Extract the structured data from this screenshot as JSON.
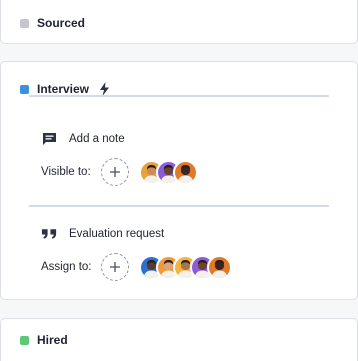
{
  "stages": {
    "sourced": {
      "label": "Sourced",
      "color": "#c4c6cb"
    },
    "interview": {
      "label": "Interview",
      "color": "#3d8fe0",
      "icon": "lightning-bolt-icon",
      "actions": [
        {
          "title": "Add a note",
          "icon": "chat-bubble-icon",
          "assign_label": "Visible to:",
          "avatars": [
            {
              "bg": "#e8a23a",
              "skin": "#c98a5c"
            },
            {
              "bg": "#8e5bd6",
              "skin": "#6a4432"
            },
            {
              "bg": "#e07a2a",
              "skin": "#3b2620"
            }
          ]
        },
        {
          "title": "Evaluation request",
          "icon": "quote-icon",
          "assign_label": "Assign to:",
          "avatars": [
            {
              "bg": "#2f6fd0",
              "skin": "#5a3a2c"
            },
            {
              "bg": "#f09a3a",
              "skin": "#d8a57e"
            },
            {
              "bg": "#f2b640",
              "skin": "#a8734e"
            },
            {
              "bg": "#8e5bd6",
              "skin": "#6a4432"
            },
            {
              "bg": "#e07a2a",
              "skin": "#3b2620"
            }
          ]
        }
      ]
    },
    "hired": {
      "label": "Hired",
      "color": "#5cc97a"
    }
  }
}
